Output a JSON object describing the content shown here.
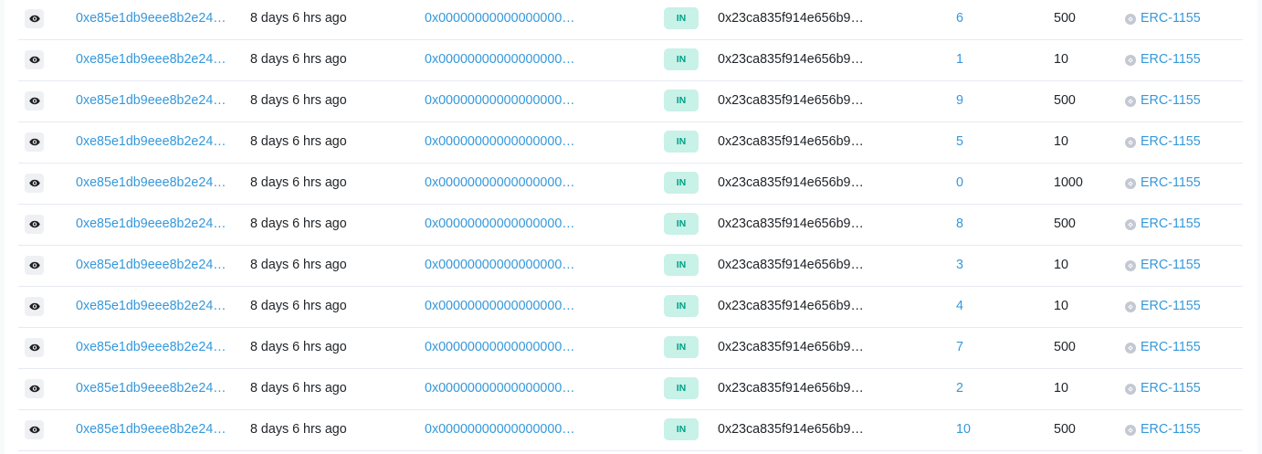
{
  "rows": [
    {
      "txn_hash": "0xe85e1db9eee8b2e244…",
      "age": "8 days 6 hrs ago",
      "from": "0x000000000000000000…",
      "direction": "IN",
      "to": "0x23ca835f914e656b99…",
      "token_id": "6",
      "value": "500",
      "token": "ERC-1155"
    },
    {
      "txn_hash": "0xe85e1db9eee8b2e244…",
      "age": "8 days 6 hrs ago",
      "from": "0x000000000000000000…",
      "direction": "IN",
      "to": "0x23ca835f914e656b99…",
      "token_id": "1",
      "value": "10",
      "token": "ERC-1155"
    },
    {
      "txn_hash": "0xe85e1db9eee8b2e244…",
      "age": "8 days 6 hrs ago",
      "from": "0x000000000000000000…",
      "direction": "IN",
      "to": "0x23ca835f914e656b99…",
      "token_id": "9",
      "value": "500",
      "token": "ERC-1155"
    },
    {
      "txn_hash": "0xe85e1db9eee8b2e244…",
      "age": "8 days 6 hrs ago",
      "from": "0x000000000000000000…",
      "direction": "IN",
      "to": "0x23ca835f914e656b99…",
      "token_id": "5",
      "value": "10",
      "token": "ERC-1155"
    },
    {
      "txn_hash": "0xe85e1db9eee8b2e244…",
      "age": "8 days 6 hrs ago",
      "from": "0x000000000000000000…",
      "direction": "IN",
      "to": "0x23ca835f914e656b99…",
      "token_id": "0",
      "value": "1000",
      "token": "ERC-1155"
    },
    {
      "txn_hash": "0xe85e1db9eee8b2e244…",
      "age": "8 days 6 hrs ago",
      "from": "0x000000000000000000…",
      "direction": "IN",
      "to": "0x23ca835f914e656b99…",
      "token_id": "8",
      "value": "500",
      "token": "ERC-1155"
    },
    {
      "txn_hash": "0xe85e1db9eee8b2e244…",
      "age": "8 days 6 hrs ago",
      "from": "0x000000000000000000…",
      "direction": "IN",
      "to": "0x23ca835f914e656b99…",
      "token_id": "3",
      "value": "10",
      "token": "ERC-1155"
    },
    {
      "txn_hash": "0xe85e1db9eee8b2e244…",
      "age": "8 days 6 hrs ago",
      "from": "0x000000000000000000…",
      "direction": "IN",
      "to": "0x23ca835f914e656b99…",
      "token_id": "4",
      "value": "10",
      "token": "ERC-1155"
    },
    {
      "txn_hash": "0xe85e1db9eee8b2e244…",
      "age": "8 days 6 hrs ago",
      "from": "0x000000000000000000…",
      "direction": "IN",
      "to": "0x23ca835f914e656b99…",
      "token_id": "7",
      "value": "500",
      "token": "ERC-1155"
    },
    {
      "txn_hash": "0xe85e1db9eee8b2e244…",
      "age": "8 days 6 hrs ago",
      "from": "0x000000000000000000…",
      "direction": "IN",
      "to": "0x23ca835f914e656b99…",
      "token_id": "2",
      "value": "10",
      "token": "ERC-1155"
    },
    {
      "txn_hash": "0xe85e1db9eee8b2e244…",
      "age": "8 days 6 hrs ago",
      "from": "0x000000000000000000…",
      "direction": "IN",
      "to": "0x23ca835f914e656b99…",
      "token_id": "10",
      "value": "500",
      "token": "ERC-1155"
    }
  ],
  "icons": {
    "view": "eye-icon",
    "token": "token-logo-icon"
  },
  "colors": {
    "link": "#3498db",
    "badge_bg": "#c8f1e7",
    "badge_text": "#00a186",
    "row_border": "#e7eaf3"
  }
}
